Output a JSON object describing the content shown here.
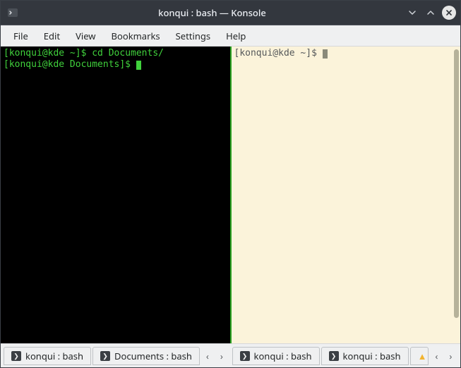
{
  "titlebar": {
    "title": "konqui : bash — Konsole"
  },
  "menu": {
    "file": "File",
    "edit": "Edit",
    "view": "View",
    "bookmarks": "Bookmarks",
    "settings": "Settings",
    "help": "Help"
  },
  "term_left": {
    "line1_prompt": "[konqui@kde ~]$ ",
    "line1_cmd": "cd Documents/",
    "line2_prompt": "[konqui@kde Documents]$ "
  },
  "term_right": {
    "line1_prompt": "[konqui@kde ~]$ "
  },
  "tabs": {
    "left": [
      {
        "label": "konqui : bash"
      },
      {
        "label": "Documents : bash"
      }
    ],
    "right": [
      {
        "label": "konqui : bash"
      },
      {
        "label": "konqui : bash"
      }
    ]
  },
  "icons": {
    "chevron_left": "‹",
    "chevron_right": "›",
    "chevron_down": "⌄",
    "chevron_up": "⌃",
    "close_x": "✕",
    "prompt_glyph": "❯",
    "bell": "▲"
  }
}
